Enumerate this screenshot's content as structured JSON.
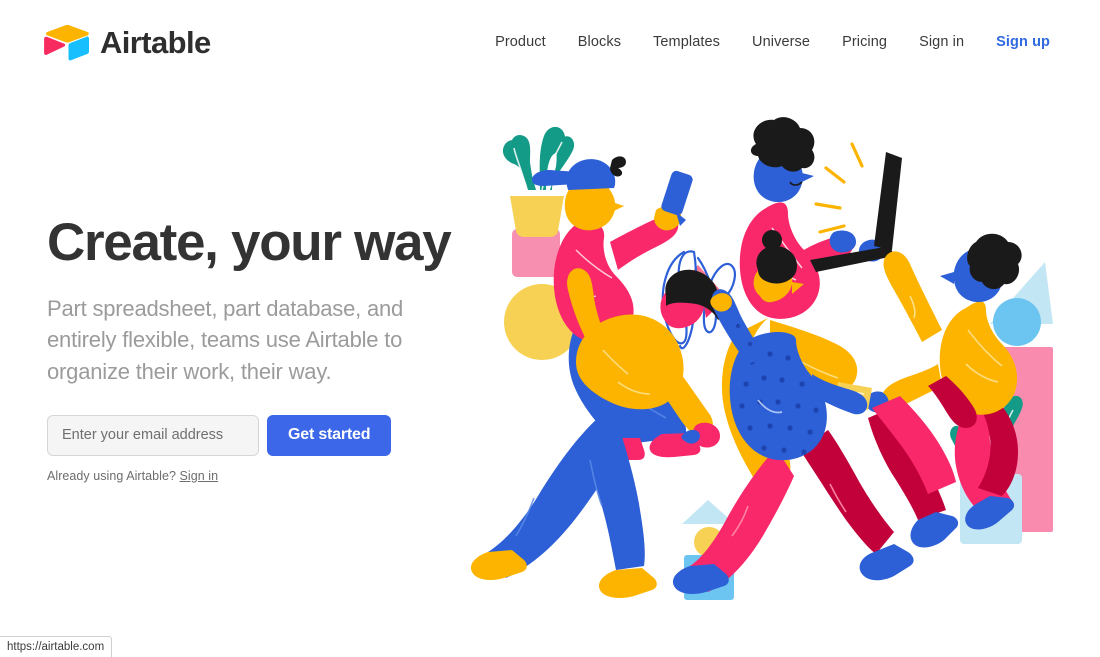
{
  "header": {
    "brand": {
      "name": "Airtable",
      "logo_icon": "airtable-cube-logo",
      "colors": {
        "top": "#FCB400",
        "left": "#F82B60",
        "right": "#18BFFF"
      }
    },
    "nav": [
      {
        "label": "Product",
        "accent": false
      },
      {
        "label": "Blocks",
        "accent": false
      },
      {
        "label": "Templates",
        "accent": false
      },
      {
        "label": "Universe",
        "accent": false
      },
      {
        "label": "Pricing",
        "accent": false
      },
      {
        "label": "Sign in",
        "accent": false
      },
      {
        "label": "Sign up",
        "accent": true
      }
    ]
  },
  "hero": {
    "headline": "Create, your way",
    "subheadline": "Part spreadsheet, part database, and entirely flexible, teams use Airtable to organize their work, their way.",
    "form": {
      "email_placeholder": "Enter your email address",
      "email_value": "",
      "cta_label": "Get started"
    },
    "signin_prompt": "Already using Airtable?",
    "signin_link": "Sign in"
  },
  "illustration": {
    "alt": "Illustration of people collaborating with laptops, phones, plants and geometric shapes",
    "palette": {
      "pink": "#F8286A",
      "crimson": "#C2003A",
      "yellow": "#FCB400",
      "lightyellow": "#F7D154",
      "blue": "#2D5FD6",
      "royal": "#3353CC",
      "skyblue": "#5AC8F5",
      "paleblue": "#C3E6F5",
      "teal": "#149B87",
      "lightpink": "#F98BAE",
      "black": "#1A1A1A",
      "white": "#FFFFFF"
    }
  },
  "browser": {
    "status_url": "https://airtable.com"
  },
  "colors": {
    "accent_blue": "#2f6ae0",
    "cta_blue": "#3b67e8",
    "headline": "#333333",
    "subhead_gray": "#9b9b9b"
  }
}
